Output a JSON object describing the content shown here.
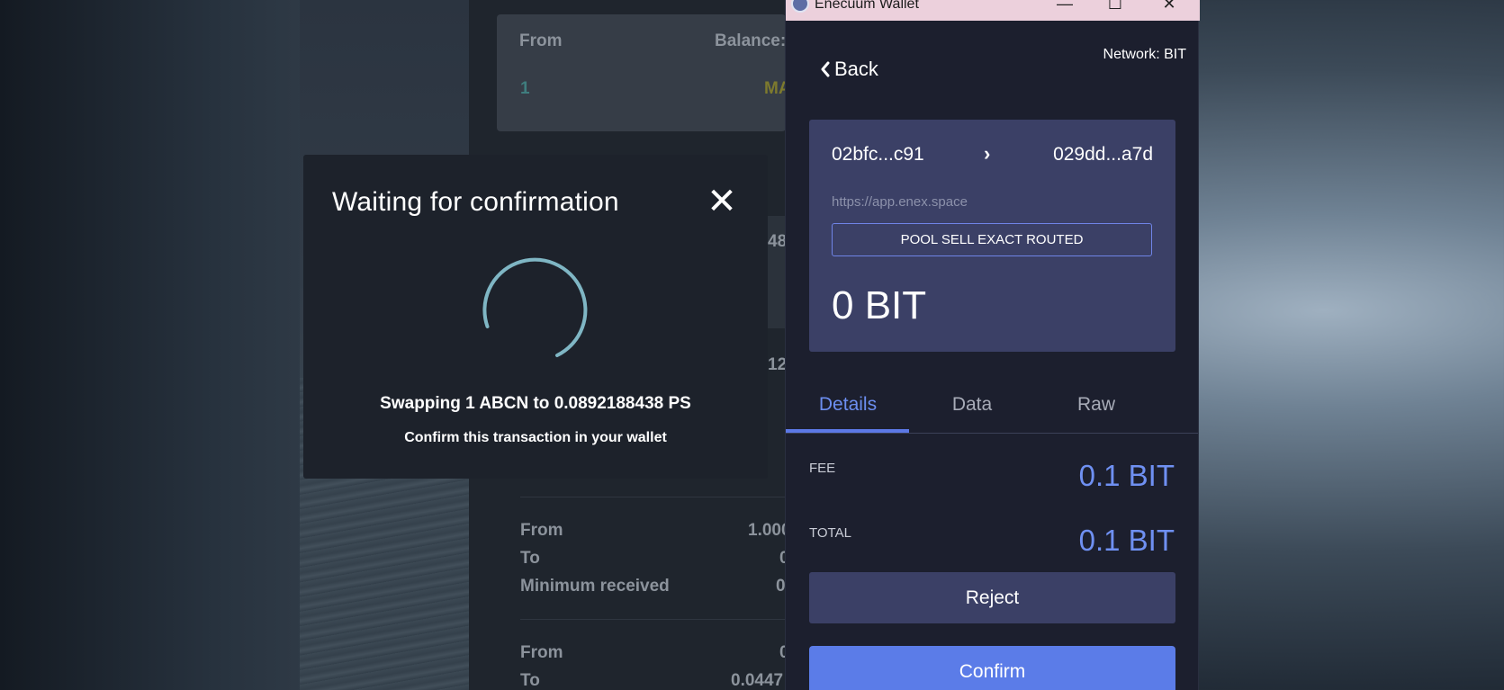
{
  "dapp": {
    "from_label": "From",
    "balance_label": "Balance:",
    "from_amount": "1",
    "balance_value": "MA",
    "mid_value_1": "48",
    "mid_value_2": "12",
    "summary": [
      {
        "label": "From",
        "value": "1.000"
      },
      {
        "label": "To",
        "value": "0"
      },
      {
        "label": "Minimum received",
        "value": "0"
      }
    ],
    "summary2": [
      {
        "label": "From",
        "value": "0"
      },
      {
        "label": "To",
        "value": "0.0447"
      }
    ]
  },
  "modal": {
    "title": "Waiting for confirmation",
    "close_glyph": "✕",
    "swap_text": "Swapping 1 ABCN to 0.0892188438 PS",
    "hint_text": "Confirm this transaction in your wallet",
    "spinner_color": "#7fb6c4"
  },
  "wallet": {
    "window_title": "Enecuum Wallet",
    "minimize_glyph": "—",
    "maximize_glyph": "☐",
    "close_glyph": "✕",
    "back_label": "Back",
    "network_label": "Network: BIT",
    "from_address": "02bfc...c91",
    "to_address": "029dd...a7d",
    "arrow_glyph": "›",
    "origin": "https://app.enex.space",
    "method": "POOL SELL EXACT ROUTED",
    "amount": "0 BIT",
    "tabs": [
      {
        "label": "Details",
        "active": true
      },
      {
        "label": "Data",
        "active": false
      },
      {
        "label": "Raw",
        "active": false
      }
    ],
    "fee_label": "FEE",
    "fee_value": "0.1 BIT",
    "total_label": "TOTAL",
    "total_value": "0.1 BIT",
    "reject_label": "Reject",
    "confirm_label": "Confirm",
    "accent_color": "#5b7ce8"
  }
}
